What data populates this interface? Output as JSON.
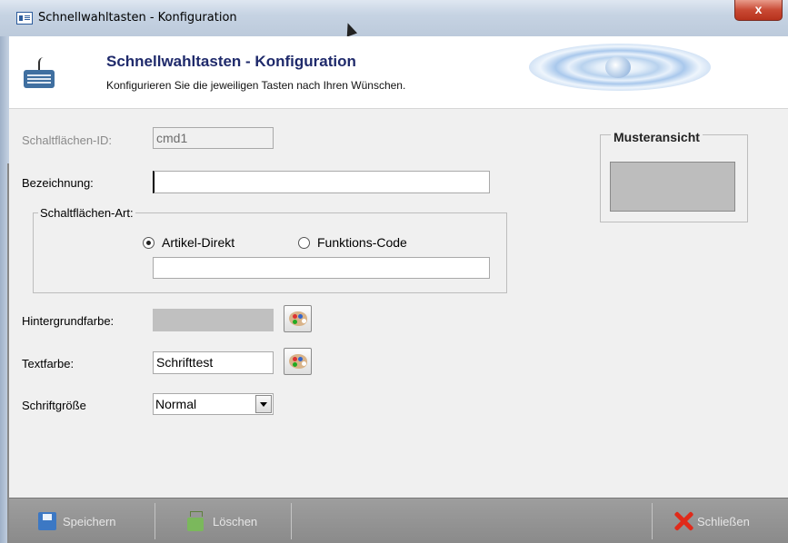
{
  "window": {
    "title": "Schnellwahltasten - Konfiguration",
    "close_label": "x"
  },
  "header": {
    "title": "Schnellwahltasten - Konfiguration",
    "subtitle": "Konfigurieren Sie die jeweiligen Tasten nach Ihren Wünschen.",
    "icon": "keyboard-icon"
  },
  "form": {
    "id_label": "Schaltflächen-ID:",
    "id_value": "cmd1",
    "name_label": "Bezeichnung:",
    "name_value": "",
    "type_group_label": "Schaltflächen-Art:",
    "type_options": [
      {
        "label": "Artikel-Direkt",
        "selected": true
      },
      {
        "label": "Funktions-Code",
        "selected": false
      }
    ],
    "type_value": "",
    "bg_label": "Hintergrundfarbe:",
    "bg_color": "#c0c0c0",
    "text_color_label": "Textfarbe:",
    "text_sample": "Schrifttest",
    "font_size_label": "Schriftgröße",
    "font_size_value": "Normal"
  },
  "preview": {
    "label": "Musteransicht",
    "button_color": "#bdbdbd"
  },
  "toolbar": {
    "save_label": "Speichern",
    "delete_label": "Löschen",
    "close_label": "Schließen"
  },
  "colors": {
    "header_title": "#1f2a6b",
    "toolbar_bg": "#8f8f8f",
    "close_red": "#e02a1a"
  }
}
